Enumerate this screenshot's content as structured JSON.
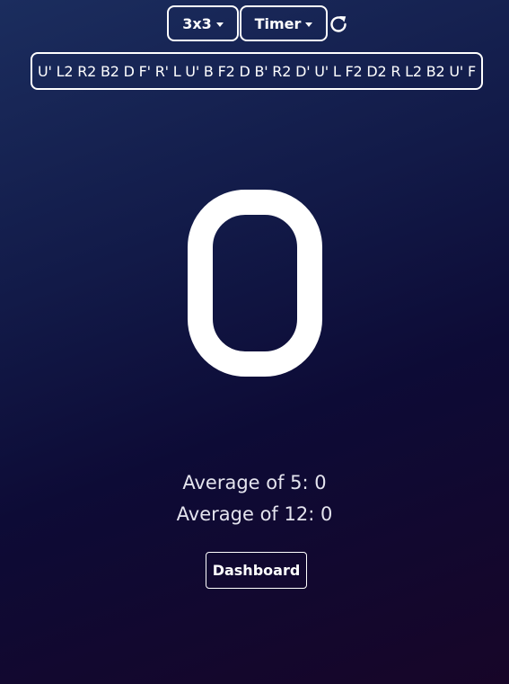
{
  "toolbar": {
    "puzzle_label": "3x3",
    "mode_label": "Timer",
    "refresh_icon": "refresh-icon"
  },
  "scramble": "U' L2 R2 B2 D F' R' L U' B F2 D B' R2 D' U' L F2 D2 R L2 B2 U' F",
  "timer": {
    "value": "0"
  },
  "stats": {
    "average_5": "Average of 5: 0",
    "average_12": "Average of 12: 0"
  },
  "dashboard_label": "Dashboard",
  "colors": {
    "background_start": "#1b2d5e",
    "background_end": "#170528",
    "text": "#ffffff"
  }
}
